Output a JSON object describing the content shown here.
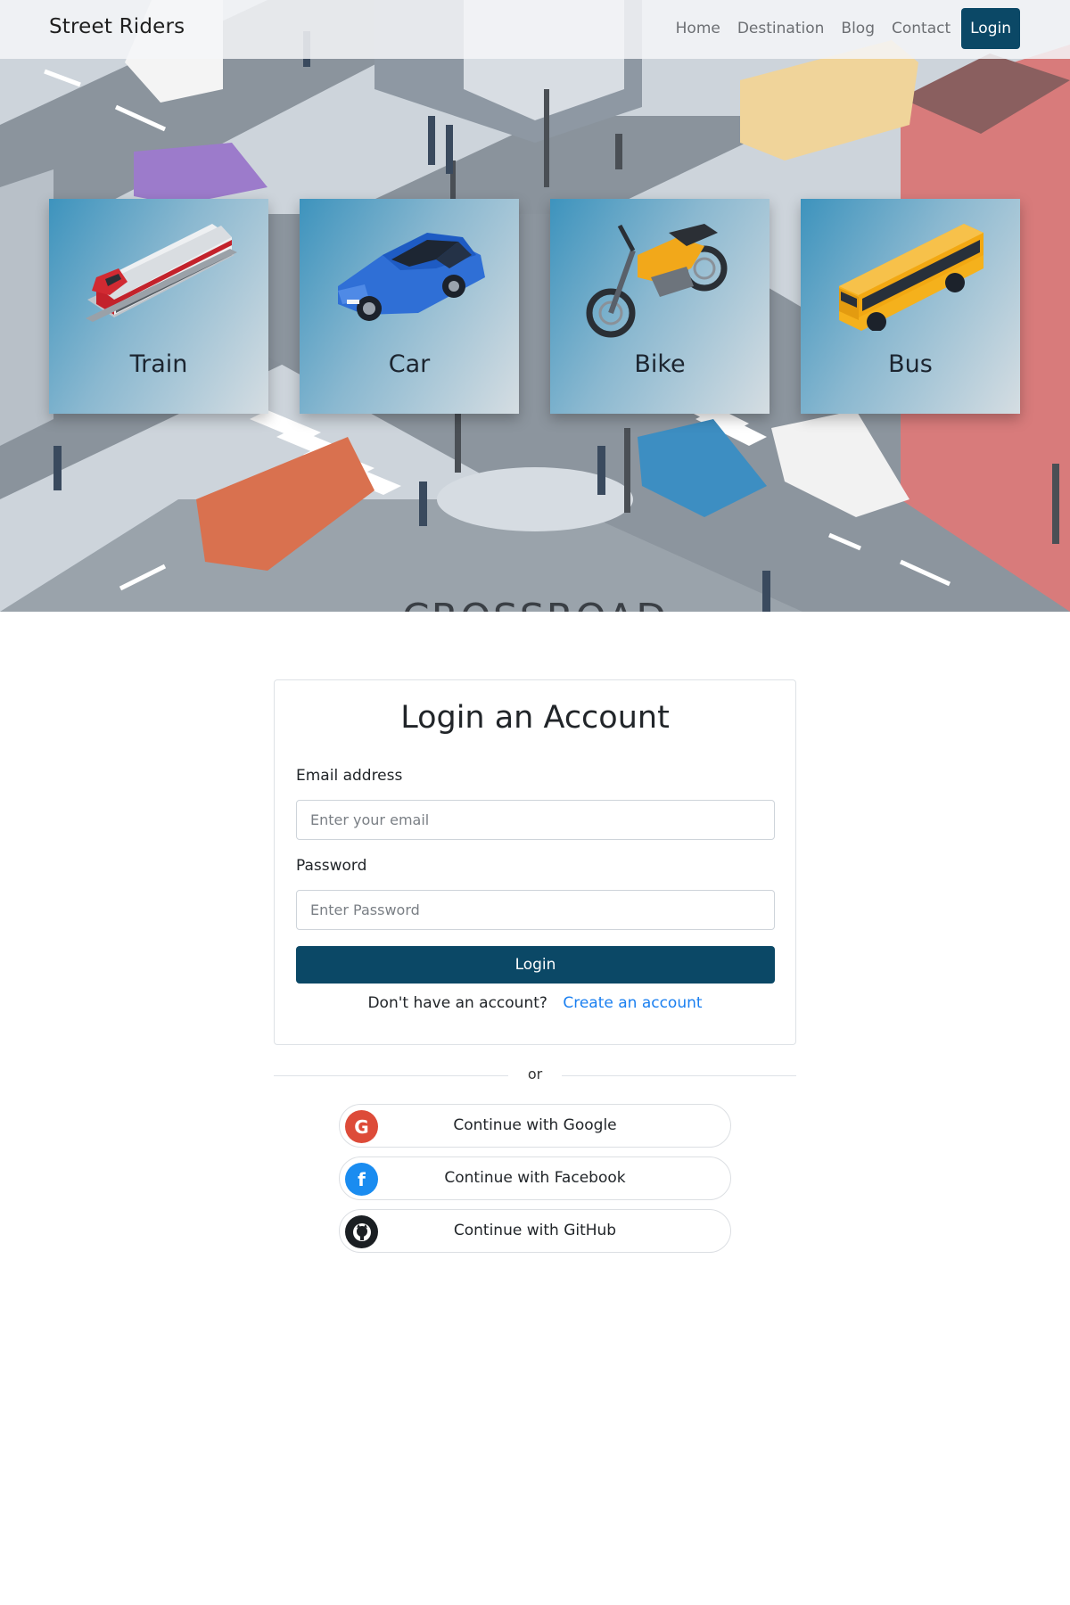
{
  "navbar": {
    "brand": "Street Riders",
    "links": [
      "Home",
      "Destination",
      "Blog",
      "Contact"
    ],
    "login": "Login"
  },
  "hero": {
    "partial_sign_text": "CROSSROAD",
    "cards": [
      {
        "label": "Train",
        "icon": "train-icon"
      },
      {
        "label": "Car",
        "icon": "car-icon"
      },
      {
        "label": "Bike",
        "icon": "bike-icon"
      },
      {
        "label": "Bus",
        "icon": "bus-icon"
      }
    ]
  },
  "login_form": {
    "title": "Login an Account",
    "email_label": "Email address",
    "email_placeholder": "Enter your email",
    "email_value": "",
    "password_label": "Password",
    "password_placeholder": "Enter Password",
    "password_value": "",
    "submit": "Login",
    "signup_prompt": "Don't have an account?",
    "signup_link": "Create an account"
  },
  "divider": {
    "text": "or"
  },
  "social": [
    {
      "label": "Continue with Google",
      "icon": "google-icon",
      "color": "#dd4b39"
    },
    {
      "label": "Continue with Facebook",
      "icon": "facebook-icon",
      "color": "#1877f2"
    },
    {
      "label": "Continue with GitHub",
      "icon": "github-icon",
      "color": "#1b1f23"
    }
  ],
  "colors": {
    "primary": "#0b4866",
    "link": "#1a7ff0"
  }
}
